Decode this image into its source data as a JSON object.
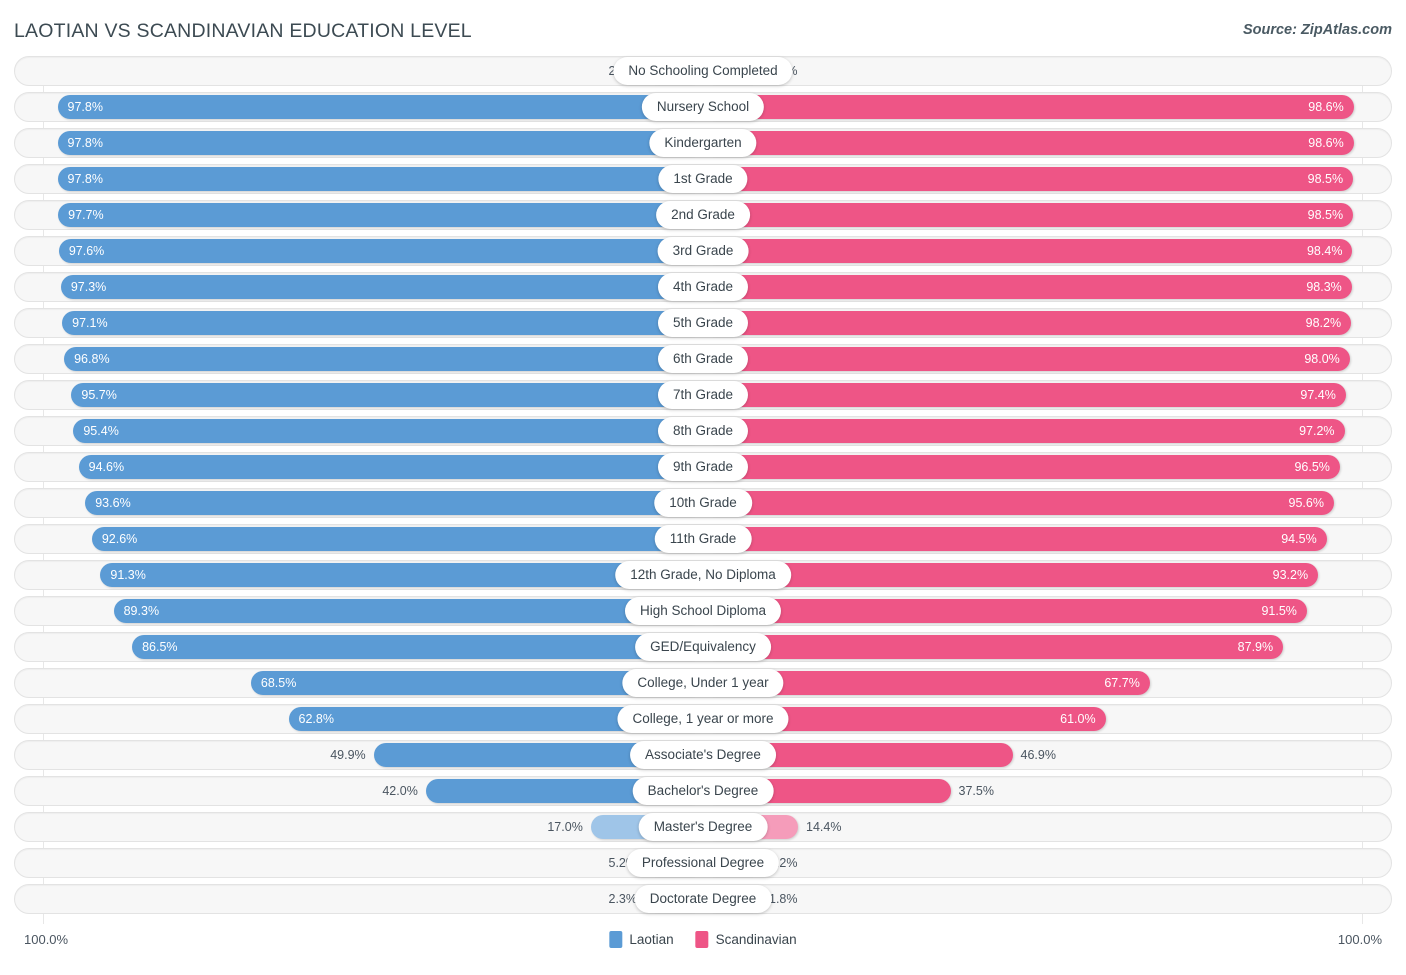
{
  "header": {
    "title": "LAOTIAN VS SCANDINAVIAN EDUCATION LEVEL",
    "source": "Source: ZipAtlas.com"
  },
  "footer": {
    "axis_left": "100.0%",
    "axis_right": "100.0%",
    "legend": [
      {
        "label": "Laotian",
        "color": "#5b9bd5"
      },
      {
        "label": "Scandinavian",
        "color": "#ee5586"
      }
    ]
  },
  "colors": {
    "laotian": "#5b9bd5",
    "laotian_light": "#9fc5e8",
    "scandinavian": "#ee5586",
    "scandinavian_light": "#f59cba",
    "track": "#f7f7f7",
    "track_border": "#e3e3e3"
  },
  "chart_data": {
    "type": "bar",
    "orientation": "diverging-horizontal",
    "title": "LAOTIAN VS SCANDINAVIAN EDUCATION LEVEL",
    "xlabel": "",
    "ylabel": "",
    "xlim": [
      0,
      100
    ],
    "grid": false,
    "legend_position": "bottom-center",
    "categories": [
      "No Schooling Completed",
      "Nursery School",
      "Kindergarten",
      "1st Grade",
      "2nd Grade",
      "3rd Grade",
      "4th Grade",
      "5th Grade",
      "6th Grade",
      "7th Grade",
      "8th Grade",
      "9th Grade",
      "10th Grade",
      "11th Grade",
      "12th Grade, No Diploma",
      "High School Diploma",
      "GED/Equivalency",
      "College, Under 1 year",
      "College, 1 year or more",
      "Associate's Degree",
      "Bachelor's Degree",
      "Master's Degree",
      "Professional Degree",
      "Doctorate Degree"
    ],
    "series": [
      {
        "name": "Laotian",
        "color": "#5b9bd5",
        "values": [
          2.2,
          97.8,
          97.8,
          97.8,
          97.7,
          97.6,
          97.3,
          97.1,
          96.8,
          95.7,
          95.4,
          94.6,
          93.6,
          92.6,
          91.3,
          89.3,
          86.5,
          68.5,
          62.8,
          49.9,
          42.0,
          17.0,
          5.2,
          2.3
        ],
        "labels": [
          "2.2%",
          "97.8%",
          "97.8%",
          "97.8%",
          "97.7%",
          "97.6%",
          "97.3%",
          "97.1%",
          "96.8%",
          "95.7%",
          "95.4%",
          "94.6%",
          "93.6%",
          "92.6%",
          "91.3%",
          "89.3%",
          "86.5%",
          "68.5%",
          "62.8%",
          "49.9%",
          "42.0%",
          "17.0%",
          "5.2%",
          "2.3%"
        ]
      },
      {
        "name": "Scandinavian",
        "color": "#ee5586",
        "values": [
          1.5,
          98.6,
          98.6,
          98.5,
          98.5,
          98.4,
          98.3,
          98.2,
          98.0,
          97.4,
          97.2,
          96.5,
          95.6,
          94.5,
          93.2,
          91.5,
          87.9,
          67.7,
          61.0,
          46.9,
          37.5,
          14.4,
          4.2,
          1.8
        ],
        "labels": [
          "1.5%",
          "98.6%",
          "98.6%",
          "98.5%",
          "98.5%",
          "98.4%",
          "98.3%",
          "98.2%",
          "98.0%",
          "97.4%",
          "97.2%",
          "96.5%",
          "95.6%",
          "94.5%",
          "93.2%",
          "91.5%",
          "87.9%",
          "67.7%",
          "61.0%",
          "46.9%",
          "37.5%",
          "14.4%",
          "4.2%",
          "1.8%"
        ]
      }
    ]
  }
}
